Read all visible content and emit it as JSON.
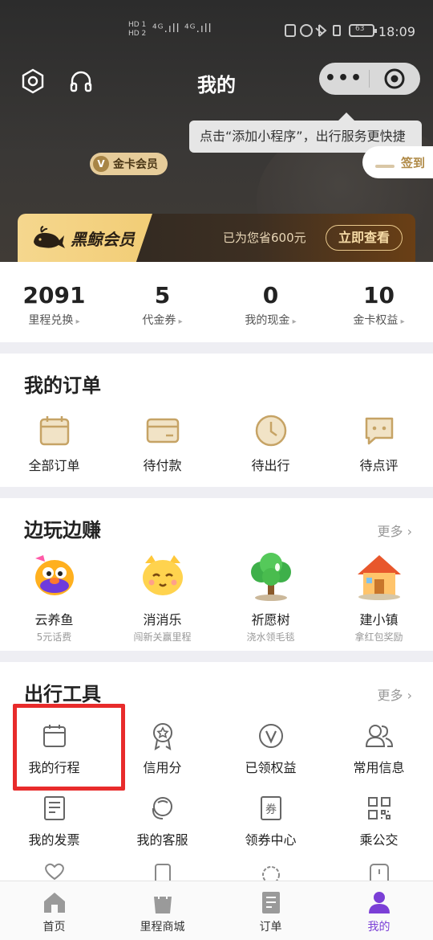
{
  "status_bar": {
    "time": "18:09",
    "sim_labels": [
      "HD 1",
      "HD 2"
    ],
    "signal": "⁴ᴳ.ıll ⁴ᴳ.ıll",
    "battery": "63"
  },
  "header": {
    "title": "我的",
    "capsule_more": "•••",
    "tooltip": "点击“添加小程序”，出行服务更快捷",
    "member_badge_v": "V",
    "member_badge": "金卡会员",
    "signin": "签到"
  },
  "vip_banner": {
    "brand": "黑鲸会员",
    "saved_text": "已为您省600元",
    "button": "立即查看"
  },
  "stats": [
    {
      "value": "2091",
      "label": "里程兑换"
    },
    {
      "value": "5",
      "label": "代金券"
    },
    {
      "value": "0",
      "label": "我的现金"
    },
    {
      "value": "10",
      "label": "金卡权益"
    }
  ],
  "orders": {
    "title": "我的订单",
    "items": [
      {
        "label": "全部订单",
        "icon": "calendar-order-icon"
      },
      {
        "label": "待付款",
        "icon": "card-icon"
      },
      {
        "label": "待出行",
        "icon": "clock-icon"
      },
      {
        "label": "待点评",
        "icon": "comment-icon"
      }
    ]
  },
  "games": {
    "title": "边玩边赚",
    "more": "更多",
    "items": [
      {
        "label": "云养鱼",
        "sub": "5元话费",
        "icon": "fish-icon"
      },
      {
        "label": "消消乐",
        "sub": "闯新关赢里程",
        "icon": "cat-icon"
      },
      {
        "label": "祈愿树",
        "sub": "浇水领毛毯",
        "icon": "tree-icon"
      },
      {
        "label": "建小镇",
        "sub": "拿红包奖励",
        "icon": "house-icon"
      }
    ]
  },
  "tools": {
    "title": "出行工具",
    "more": "更多",
    "row1": [
      {
        "label": "我的行程",
        "icon": "calendar-icon"
      },
      {
        "label": "信用分",
        "icon": "badge-icon"
      },
      {
        "label": "已领权益",
        "icon": "v-circle-icon"
      },
      {
        "label": "常用信息",
        "icon": "users-icon"
      }
    ],
    "row2": [
      {
        "label": "我的发票",
        "icon": "invoice-icon"
      },
      {
        "label": "我的客服",
        "icon": "headset-icon"
      },
      {
        "label": "领券中心",
        "icon": "coupon-icon"
      },
      {
        "label": "乘公交",
        "icon": "qrcode-icon"
      }
    ]
  },
  "tabbar": [
    {
      "label": "首页",
      "icon": "home-icon"
    },
    {
      "label": "里程商城",
      "icon": "bag-icon"
    },
    {
      "label": "订单",
      "icon": "order-icon"
    },
    {
      "label": "我的",
      "icon": "profile-icon"
    }
  ],
  "colors": {
    "gold": "#b08a47",
    "purple_active": "#7b3fd6",
    "highlight_red": "#e82b2b"
  }
}
